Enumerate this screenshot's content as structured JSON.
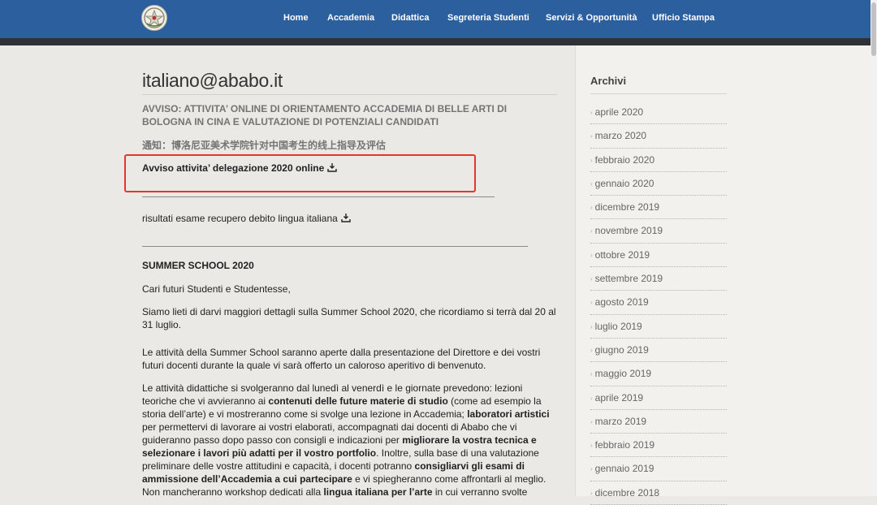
{
  "nav": {
    "items": [
      {
        "label": "Home"
      },
      {
        "label": "Accademia"
      },
      {
        "label": "Didattica"
      },
      {
        "label": "Segreteria Studenti"
      },
      {
        "label": "Servizi & Opportunità"
      },
      {
        "label": "Ufficio Stampa"
      }
    ]
  },
  "main": {
    "title": "italiano@ababo.it",
    "notice": "AVVISO: ATTIVITA’ ONLINE DI ORIENTAMENTO ACCADEMIA DI BELLE ARTI DI BOLOGNA IN CINA E VALUTAZIONE DI POTENZIALI CANDIDATI",
    "notice_cn": "通知：博洛尼亚美术学院针对中国考生的线上指导及评估",
    "avviso_link": "Avviso attivita’ delegazione 2020 online",
    "risultati_link": "risultati esame recupero debito lingua italiana",
    "summer_heading": "SUMMER SCHOOL 2020",
    "greeting": "Cari futuri Studenti e Studentesse,",
    "para1": "Siamo lieti di darvi maggiori dettagli sulla Summer School 2020, che ricordiamo si terrà dal 20 al 31 luglio.",
    "para2": "Le attività della Summer School saranno aperte dalla presentazione del Direttore e dei vostri futuri docenti durante la quale vi sarà offerto un caloroso aperitivo di benvenuto.",
    "para3": {
      "t1": "Le attività didattiche si svolgeranno dal lunedì al venerdì e le giornate prevedono: lezioni teoriche che vi avvieranno ai ",
      "b1": "contenuti delle future materie di studio",
      "t2": " (come ad esempio la storia dell’arte) e vi mostreranno come si svolge una lezione in Accademia; ",
      "b2": "laboratori artistici",
      "t3": " per permettervi di lavorare ai vostri elaborati, accompagnati dai docenti di Ababo che vi guideranno passo dopo passo con consigli e indicazioni per ",
      "b3": "migliorare la vostra tecnica e selezionare i lavori più adatti per il vostro portfolio",
      "t4": ". Inoltre, sulla base di una valutazione preliminare delle vostre attitudini e capacità, i docenti potranno ",
      "b4": "consigliarvi gli esami di ammissione dell’Accademia a cui partecipare",
      "t5": " e vi spiegheranno come affrontarli al meglio. Non mancheranno workshop dedicati alla ",
      "b5": "lingua italiana per l’arte",
      "t6": " in cui verranno svolte"
    }
  },
  "sidebar": {
    "title": "Archivi",
    "items": [
      "aprile 2020",
      "marzo 2020",
      "febbraio 2020",
      "gennaio 2020",
      "dicembre 2019",
      "novembre 2019",
      "ottobre 2019",
      "settembre 2019",
      "agosto 2019",
      "luglio 2019",
      "giugno 2019",
      "maggio 2019",
      "aprile 2019",
      "marzo 2019",
      "febbraio 2019",
      "gennaio 2019",
      "dicembre 2018"
    ]
  },
  "colors": {
    "header": "#2c5f9e",
    "header_line": "#2e3236",
    "page_bg": "#ebe9e6",
    "highlight": "#e2362e"
  },
  "icons": {
    "logo": "italian-emblem-icon",
    "download": "download-icon",
    "chevron": "chevron-right-icon"
  }
}
